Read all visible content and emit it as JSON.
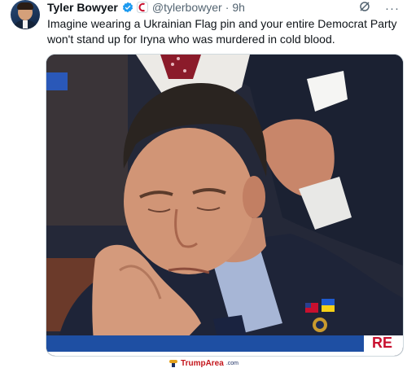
{
  "tweet": {
    "author_name": "Tyler Bowyer",
    "handle": "@tylerbowyer",
    "separator": "·",
    "time": "9h",
    "text": "Imagine wearing a Ukrainian Flag pin and your entire Democrat Party won't stand up for Iryna who was murdered in cold blood.",
    "more_label": "···"
  },
  "media": {
    "description": "Man in dark suit resting chin on hand with flag pins on lapel",
    "banner_right_text": "RE"
  },
  "watermark": {
    "brand": "TrumpArea",
    "suffix": ".com"
  },
  "colors": {
    "accent": "#1d9bf0",
    "muted": "#536471",
    "brand_red": "#c4161c"
  }
}
